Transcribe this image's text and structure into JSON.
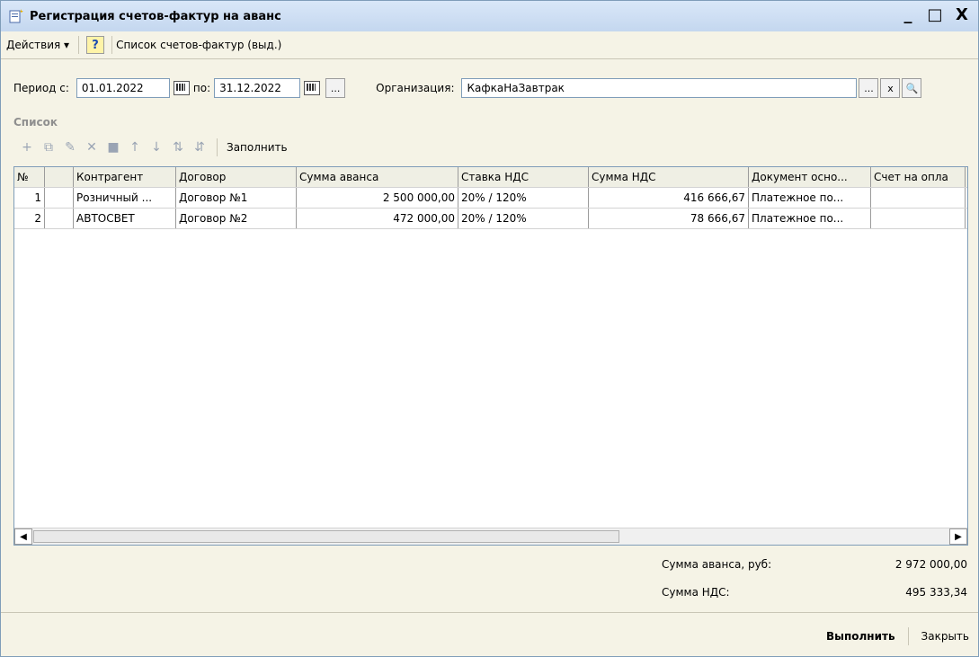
{
  "window": {
    "title": "Регистрация счетов-фактур на аванс",
    "controls": [
      "_",
      "□",
      "X"
    ]
  },
  "menubar": {
    "actions_label": "Действия ▾",
    "help_label": "?",
    "list_label": "Список счетов-фактур (выд.)"
  },
  "filter": {
    "period_from_label": "Период с:",
    "period_from": "01.01.2022",
    "period_to_label": "по:",
    "period_to": "31.12.2022",
    "org_label": "Организация:",
    "org_value": "КафкаНаЗавтрак",
    "ellipsis": "...",
    "clear": "x",
    "search": "🔍"
  },
  "section": {
    "title": "Список",
    "fill_label": "Заполнить"
  },
  "grid": {
    "headers": [
      "№",
      "",
      "Контрагент",
      "Договор",
      "Сумма аванса",
      "Ставка НДС",
      "Сумма НДС",
      "Документ осно...",
      "Счет на опла"
    ],
    "rows": [
      [
        "1",
        "",
        "Розничный ...",
        "Договор №1",
        "2 500 000,00",
        "20% / 120%",
        "416 666,67",
        "Платежное по...",
        ""
      ],
      [
        "2",
        "",
        "АВТОСВЕТ",
        "Договор №2",
        "472 000,00",
        "20% / 120%",
        "78 666,67",
        "Платежное по...",
        ""
      ]
    ]
  },
  "totals": {
    "advance_label": "Сумма аванса, руб:",
    "advance_value": "2 972 000,00",
    "vat_label": "Сумма НДС:",
    "vat_value": "495 333,34"
  },
  "footer": {
    "execute_label": "Выполнить",
    "close_label": "Закрыть"
  }
}
